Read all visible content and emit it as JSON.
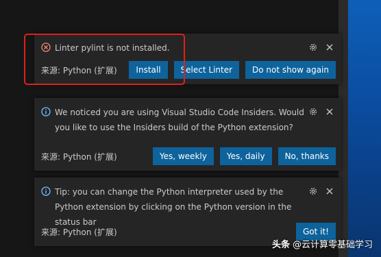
{
  "notifications": [
    {
      "severity": "error",
      "severity_icon": "error-circle-icon",
      "message": "Linter pylint is not installed.",
      "source": "来源: Python (扩展)",
      "buttons": [
        "Install",
        "Select Linter",
        "Do not show again"
      ]
    },
    {
      "severity": "info",
      "severity_icon": "info-circle-icon",
      "message": "We noticed you are using Visual Studio Code Insiders. Would you like to use the Insiders build of the Python extension?",
      "source": "来源: Python (扩展)",
      "buttons": [
        "Yes, weekly",
        "Yes, daily",
        "No, thanks"
      ]
    },
    {
      "severity": "info",
      "severity_icon": "info-circle-icon",
      "message": "Tip: you can change the Python interpreter used by the Python extension by clicking on the Python version in the status bar",
      "source": "来源: Python (扩展)",
      "buttons": [
        "Got it!"
      ]
    }
  ],
  "watermark": {
    "brand": "头条",
    "handle": "@云计算零基础学习"
  },
  "colors": {
    "toast_bg": "#252526",
    "button_bg": "#0e639c",
    "error": "#f48771",
    "info": "#75beff",
    "highlight": "#e0201b"
  }
}
